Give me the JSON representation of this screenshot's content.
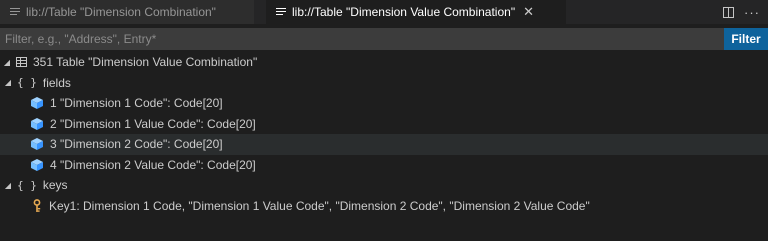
{
  "tabs": [
    {
      "label": "lib://Table \"Dimension Combination\"",
      "active": false
    },
    {
      "label": "lib://Table \"Dimension Value Combination\"",
      "active": true,
      "close_glyph": "✕"
    }
  ],
  "tab_actions": {
    "more_glyph": "···"
  },
  "filter": {
    "placeholder": "Filter, e.g., \"Address\", Entry*",
    "value": "",
    "button_label": "Filter"
  },
  "tree": {
    "root": {
      "label": "351 Table \"Dimension Value Combination\"",
      "icon": "table-icon"
    },
    "fields_group": {
      "braces": "{ }",
      "label": "fields"
    },
    "fields": [
      {
        "label": "1 \"Dimension 1 Code\": Code[20]"
      },
      {
        "label": "2 \"Dimension 1 Value Code\": Code[20]"
      },
      {
        "label": "3 \"Dimension 2 Code\": Code[20]",
        "selected": true
      },
      {
        "label": "4 \"Dimension 2 Value Code\": Code[20]"
      }
    ],
    "keys_group": {
      "braces": "{ }",
      "label": "keys"
    },
    "keys": [
      {
        "label": "Key1: Dimension 1 Code, \"Dimension 1 Value Code\", \"Dimension 2 Code\", \"Dimension 2 Value Code\""
      }
    ]
  },
  "colors": {
    "background": "#1e1e1e",
    "accent_button": "#0e639c",
    "field_icon": "#75beff",
    "key_icon": "#e8ab53"
  }
}
